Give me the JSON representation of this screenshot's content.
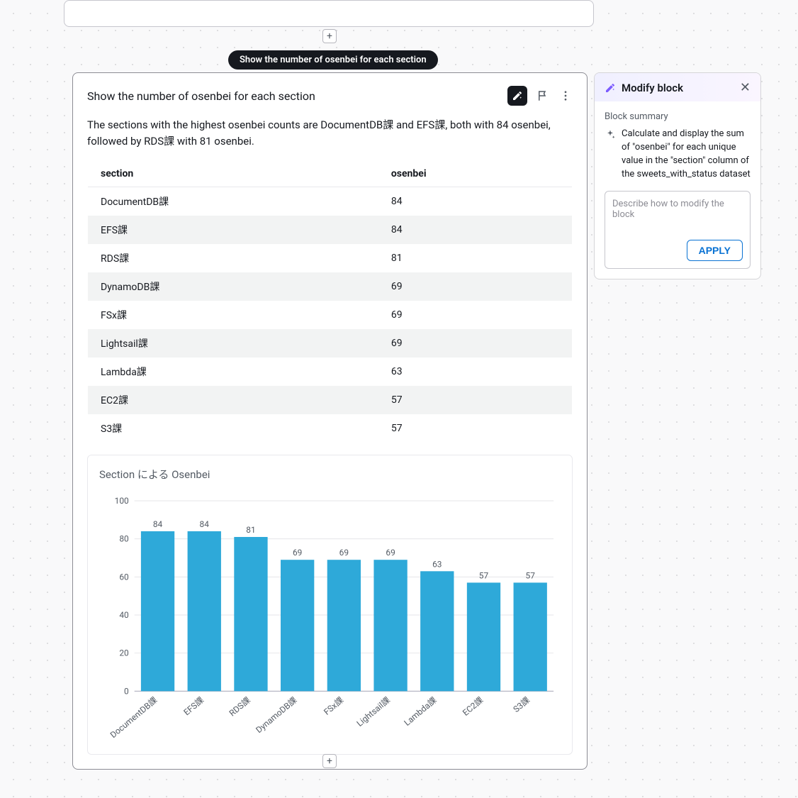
{
  "pill_label": "Show the number of osenbei for each section",
  "block": {
    "title": "Show the number of osenbei for each section",
    "summary": "The sections with the highest osenbei counts are DocumentDB課 and EFS課, both with 84 osenbei, followed by RDS課 with 81 osenbei.",
    "table": {
      "headers": {
        "col1": "section",
        "col2": "osenbei"
      },
      "rows": [
        {
          "section": "DocumentDB課",
          "osenbei": "84"
        },
        {
          "section": "EFS課",
          "osenbei": "84"
        },
        {
          "section": "RDS課",
          "osenbei": "81"
        },
        {
          "section": "DynamoDB課",
          "osenbei": "69"
        },
        {
          "section": "FSx課",
          "osenbei": "69"
        },
        {
          "section": "Lightsail課",
          "osenbei": "69"
        },
        {
          "section": "Lambda課",
          "osenbei": "63"
        },
        {
          "section": "EC2課",
          "osenbei": "57"
        },
        {
          "section": "S3課",
          "osenbei": "57"
        }
      ]
    }
  },
  "side": {
    "title": "Modify block",
    "summary_label": "Block summary",
    "summary_text": "Calculate and display the sum of \"osenbei\" for each unique value in the \"section\" column of the sweets_with_status dataset",
    "placeholder": "Describe how to modify the block",
    "apply_label": "APPLY"
  },
  "chart_data": {
    "type": "bar",
    "title": "Section による Osenbei",
    "xlabel": "",
    "ylabel": "",
    "ylim": [
      0,
      100
    ],
    "yticks": [
      0,
      20,
      40,
      60,
      80,
      100
    ],
    "categories": [
      "DocumentDB課",
      "EFS課",
      "RDS課",
      "DynamoDB課",
      "FSx課",
      "Lightsail課",
      "Lambda課",
      "EC2課",
      "S3課"
    ],
    "values": [
      84,
      84,
      81,
      69,
      69,
      69,
      63,
      57,
      57
    ],
    "bar_color": "#2ea9d9"
  }
}
